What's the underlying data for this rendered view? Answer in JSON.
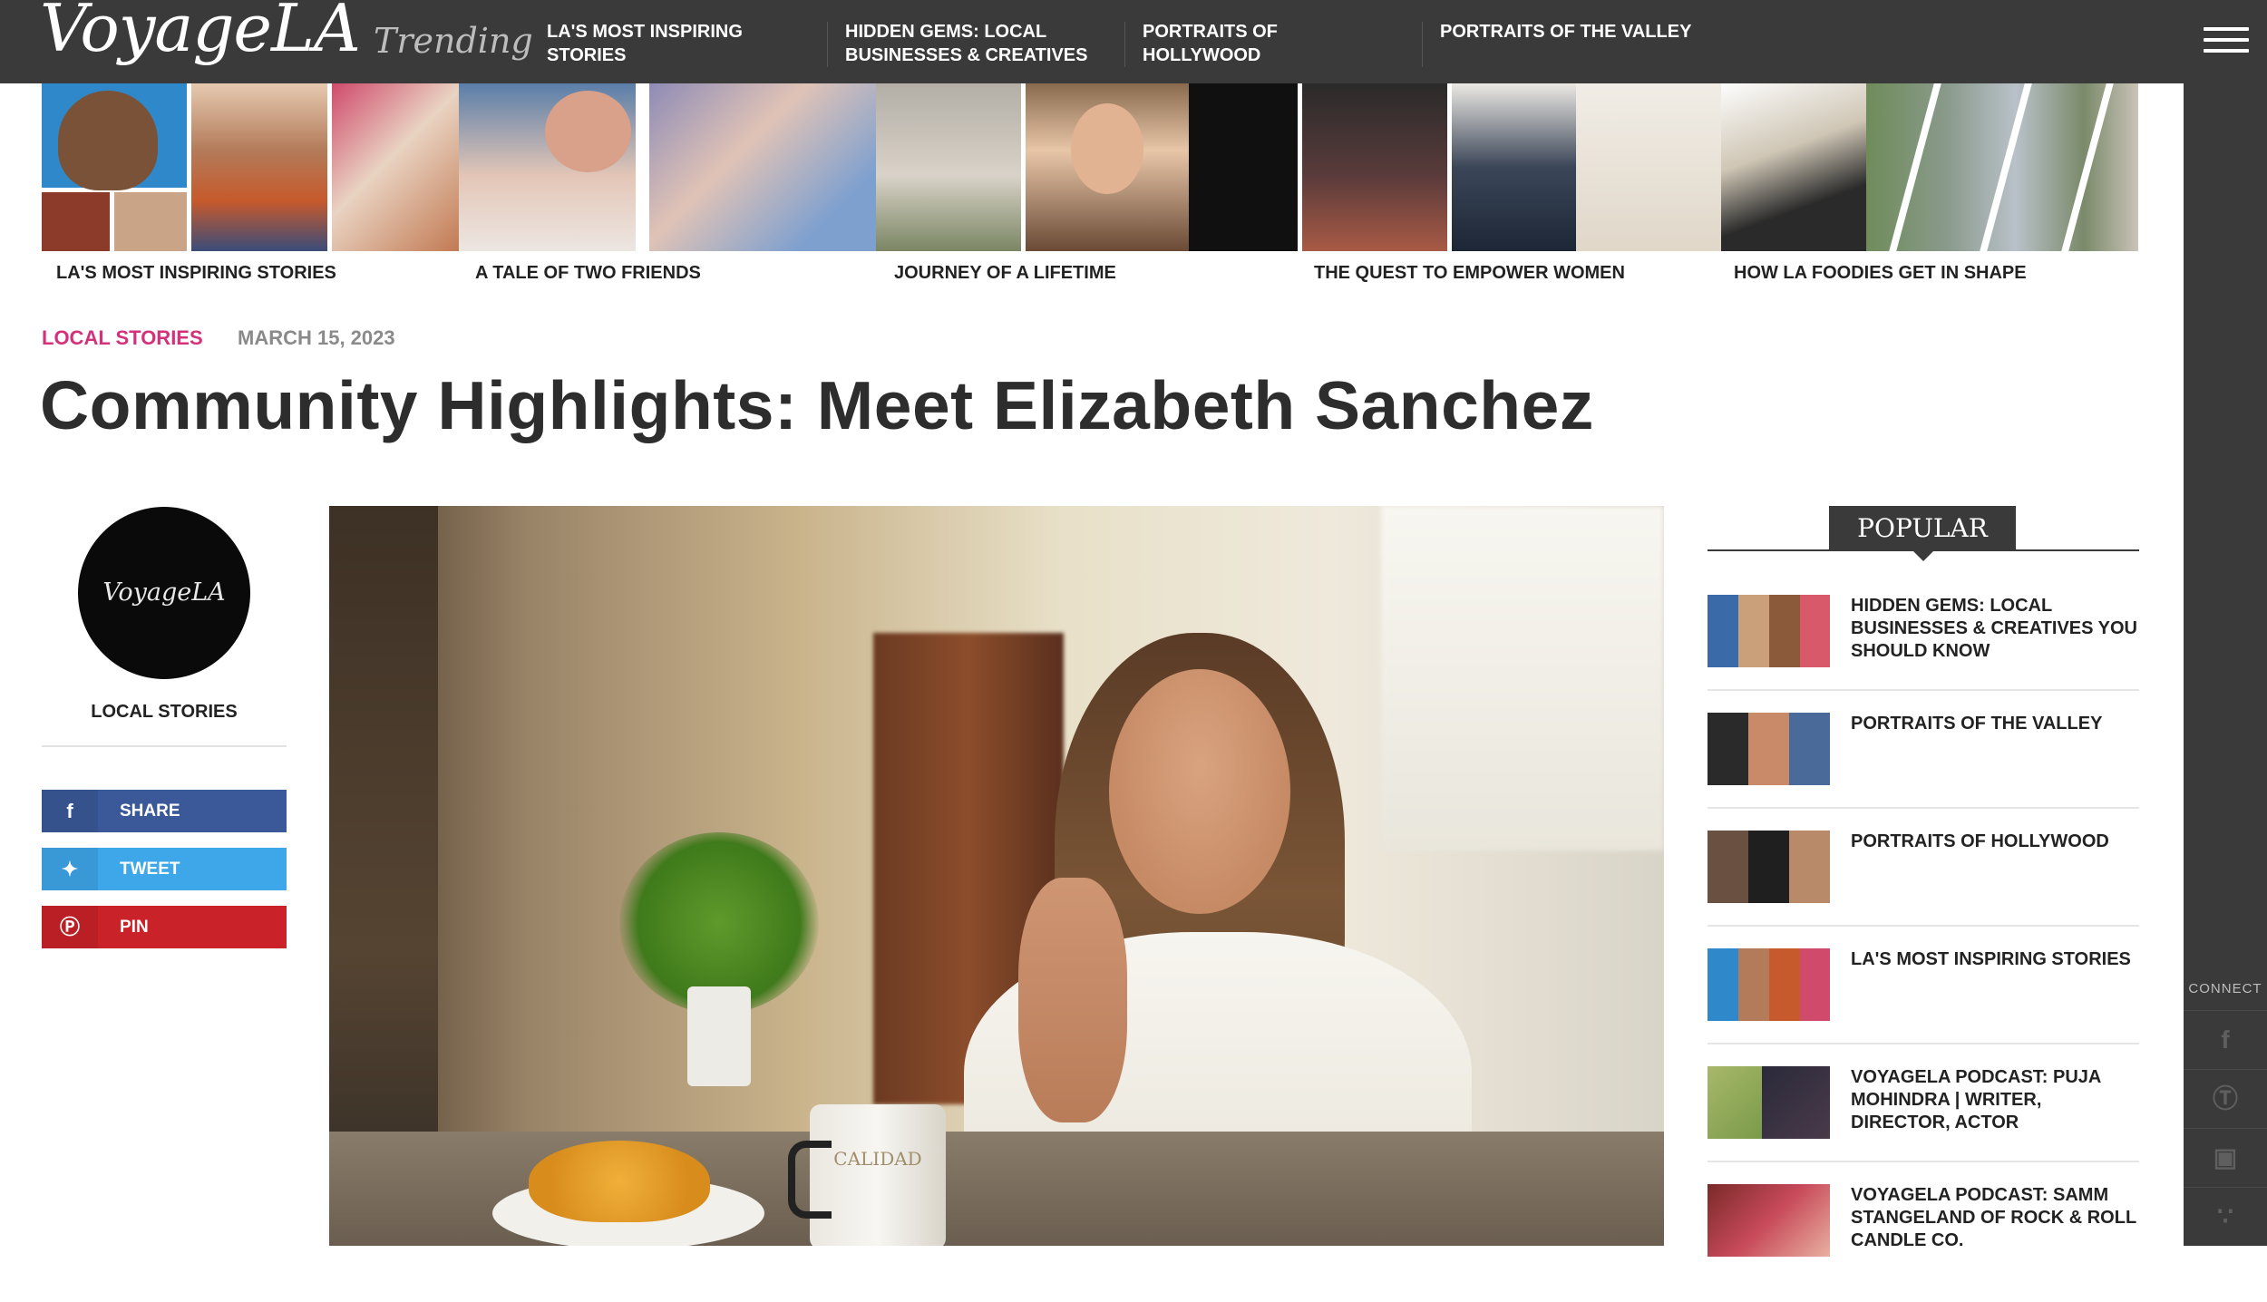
{
  "header": {
    "logo": "VoyageLA",
    "trending_label": "Trending",
    "nav": [
      "LA'S MOST INSPIRING STORIES",
      "HIDDEN GEMS: LOCAL BUSINESSES & CREATIVES",
      "PORTRAITS OF HOLLYWOOD",
      "PORTRAITS OF THE VALLEY"
    ]
  },
  "trending_strip": [
    "LA'S MOST INSPIRING STORIES",
    "A TALE OF TWO FRIENDS",
    "JOURNEY OF A LIFETIME",
    "THE QUEST TO EMPOWER WOMEN",
    "HOW LA FOODIES GET IN SHAPE"
  ],
  "article": {
    "category": "LOCAL STORIES",
    "date": "MARCH 15, 2023",
    "title": "Community Highlights: Meet Elizabeth Sanchez",
    "mug_text": "CALIDAD"
  },
  "author": {
    "avatar_text": "VoyageLA",
    "label": "LOCAL STORIES"
  },
  "share": {
    "facebook": "SHARE",
    "twitter": "TWEET",
    "pinterest": "PIN"
  },
  "popular": {
    "heading": "POPULAR",
    "items": [
      "HIDDEN GEMS: LOCAL BUSINESSES & CREATIVES YOU SHOULD KNOW",
      "PORTRAITS OF THE VALLEY",
      "PORTRAITS OF HOLLYWOOD",
      "LA'S MOST INSPIRING STORIES",
      "VOYAGELA PODCAST: PUJA MOHINDRA | WRITER, DIRECTOR, ACTOR",
      "VOYAGELA PODCAST: SAMM STANGELAND OF ROCK & ROLL CANDLE CO."
    ]
  },
  "connect": {
    "label": "CONNECT"
  },
  "colors": {
    "accent": "#d4317b",
    "dark_bar": "#3a3a3a",
    "facebook": "#3b5998",
    "twitter": "#3ea7ea",
    "pinterest": "#c92228"
  }
}
